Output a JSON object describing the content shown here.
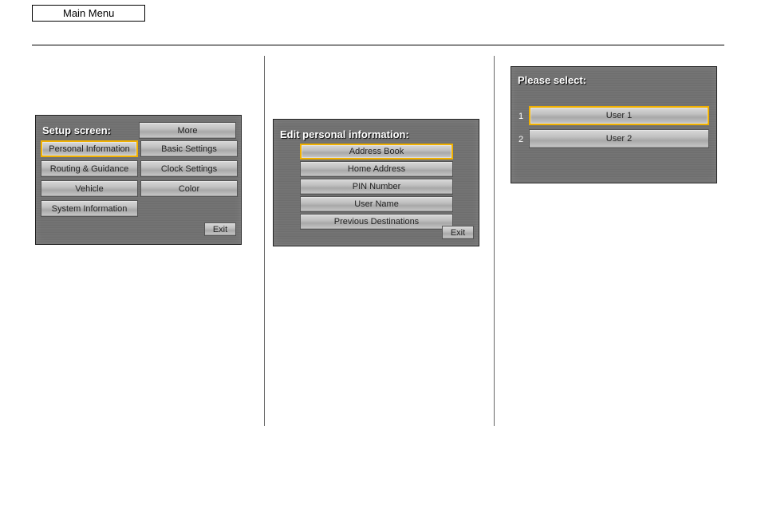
{
  "header": {
    "main_menu": "Main Menu"
  },
  "screen1": {
    "title": "Setup screen:",
    "more": "More",
    "exit": "Exit",
    "col1": [
      "Personal Information",
      "Routing & Guidance",
      "Vehicle",
      "System Information"
    ],
    "col2": [
      "Basic Settings",
      "Clock Settings",
      "Color"
    ]
  },
  "screen2": {
    "title": "Edit personal information:",
    "exit": "Exit",
    "items": [
      "Address Book",
      "Home Address",
      "PIN Number",
      "User Name",
      "Previous Destinations"
    ]
  },
  "screen3": {
    "title": "Please select:",
    "labels": [
      "1",
      "2"
    ],
    "items": [
      "User 1",
      "User 2"
    ]
  }
}
